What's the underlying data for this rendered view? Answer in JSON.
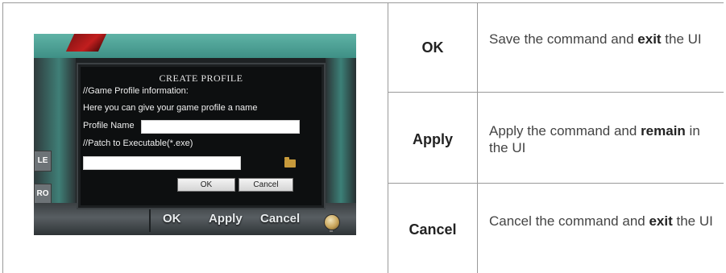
{
  "screenshot": {
    "dialog": {
      "title": "CREATE PROFILE",
      "info_line": "//Game Profile information:",
      "hint_line": "Here you can give your game profile a name",
      "profile_name_label": "Profile Name",
      "profile_name_value": "",
      "patch_label": "//Patch to Executable(*.exe)",
      "patch_value": "",
      "ok_label": "OK",
      "cancel_label": "Cancel"
    },
    "bottom_bar": {
      "ok_label": "OK",
      "apply_label": "Apply",
      "cancel_label": "Cancel"
    },
    "side_tabs": [
      "LE",
      "RO"
    ]
  },
  "table": {
    "rows": [
      {
        "command": "OK",
        "desc_pre": "Save the command and ",
        "desc_bold": "exit",
        "desc_post": " the UI"
      },
      {
        "command": "Apply",
        "desc_pre": "Apply the command and ",
        "desc_bold": "remain",
        "desc_post": " in the UI"
      },
      {
        "command": "Cancel",
        "desc_pre": "Cancel the command and ",
        "desc_bold": "exit",
        "desc_post": " the UI"
      }
    ]
  }
}
